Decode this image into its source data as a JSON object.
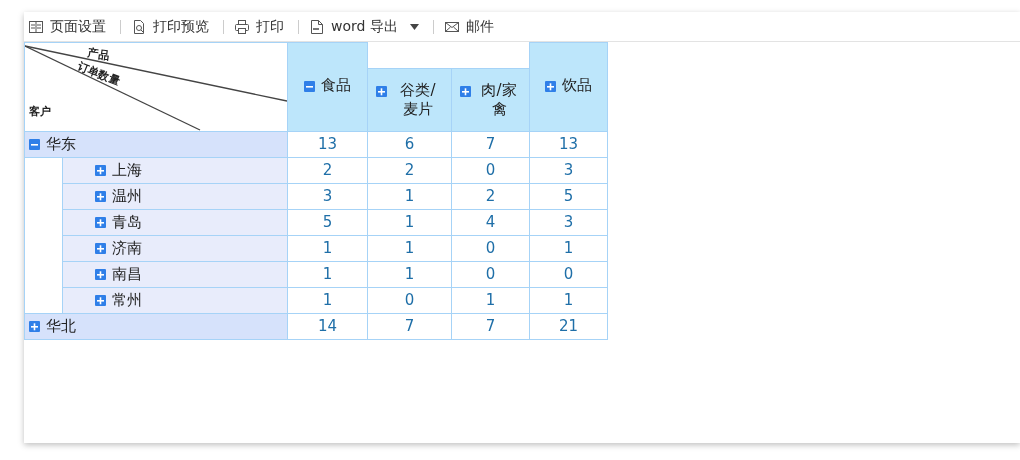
{
  "toolbar": [
    {
      "kind": "button",
      "label": "页面设置"
    },
    {
      "kind": "button",
      "label": "打印预览"
    },
    {
      "kind": "button",
      "label": "打印"
    },
    {
      "kind": "dropdown",
      "label": "word 导出"
    },
    {
      "kind": "button",
      "label": "邮件"
    }
  ],
  "corner": {
    "column_axis": "产品",
    "measure": "订单数量",
    "row_axis": "客户"
  },
  "column_groups": [
    {
      "label": "食品",
      "expanded": true,
      "children": [
        {
          "label": "谷类/麦片",
          "expanded": false
        },
        {
          "label": "肉/家禽",
          "expanded": false
        }
      ]
    },
    {
      "label": "饮品",
      "expanded": false
    }
  ],
  "rows": [
    {
      "label": "华东",
      "expanded": true,
      "values": [
        "13",
        "6",
        "7",
        "13"
      ],
      "children": [
        {
          "label": "上海",
          "expanded": false,
          "values": [
            "2",
            "2",
            "0",
            "3"
          ]
        },
        {
          "label": "温州",
          "expanded": false,
          "values": [
            "3",
            "1",
            "2",
            "5"
          ]
        },
        {
          "label": "青岛",
          "expanded": false,
          "values": [
            "5",
            "1",
            "4",
            "3"
          ]
        },
        {
          "label": "济南",
          "expanded": false,
          "values": [
            "1",
            "1",
            "0",
            "1"
          ]
        },
        {
          "label": "南昌",
          "expanded": false,
          "values": [
            "1",
            "1",
            "0",
            "0"
          ]
        },
        {
          "label": "常州",
          "expanded": false,
          "values": [
            "1",
            "0",
            "1",
            "1"
          ]
        }
      ]
    },
    {
      "label": "华北",
      "expanded": false,
      "values": [
        "14",
        "7",
        "7",
        "21"
      ]
    }
  ]
}
